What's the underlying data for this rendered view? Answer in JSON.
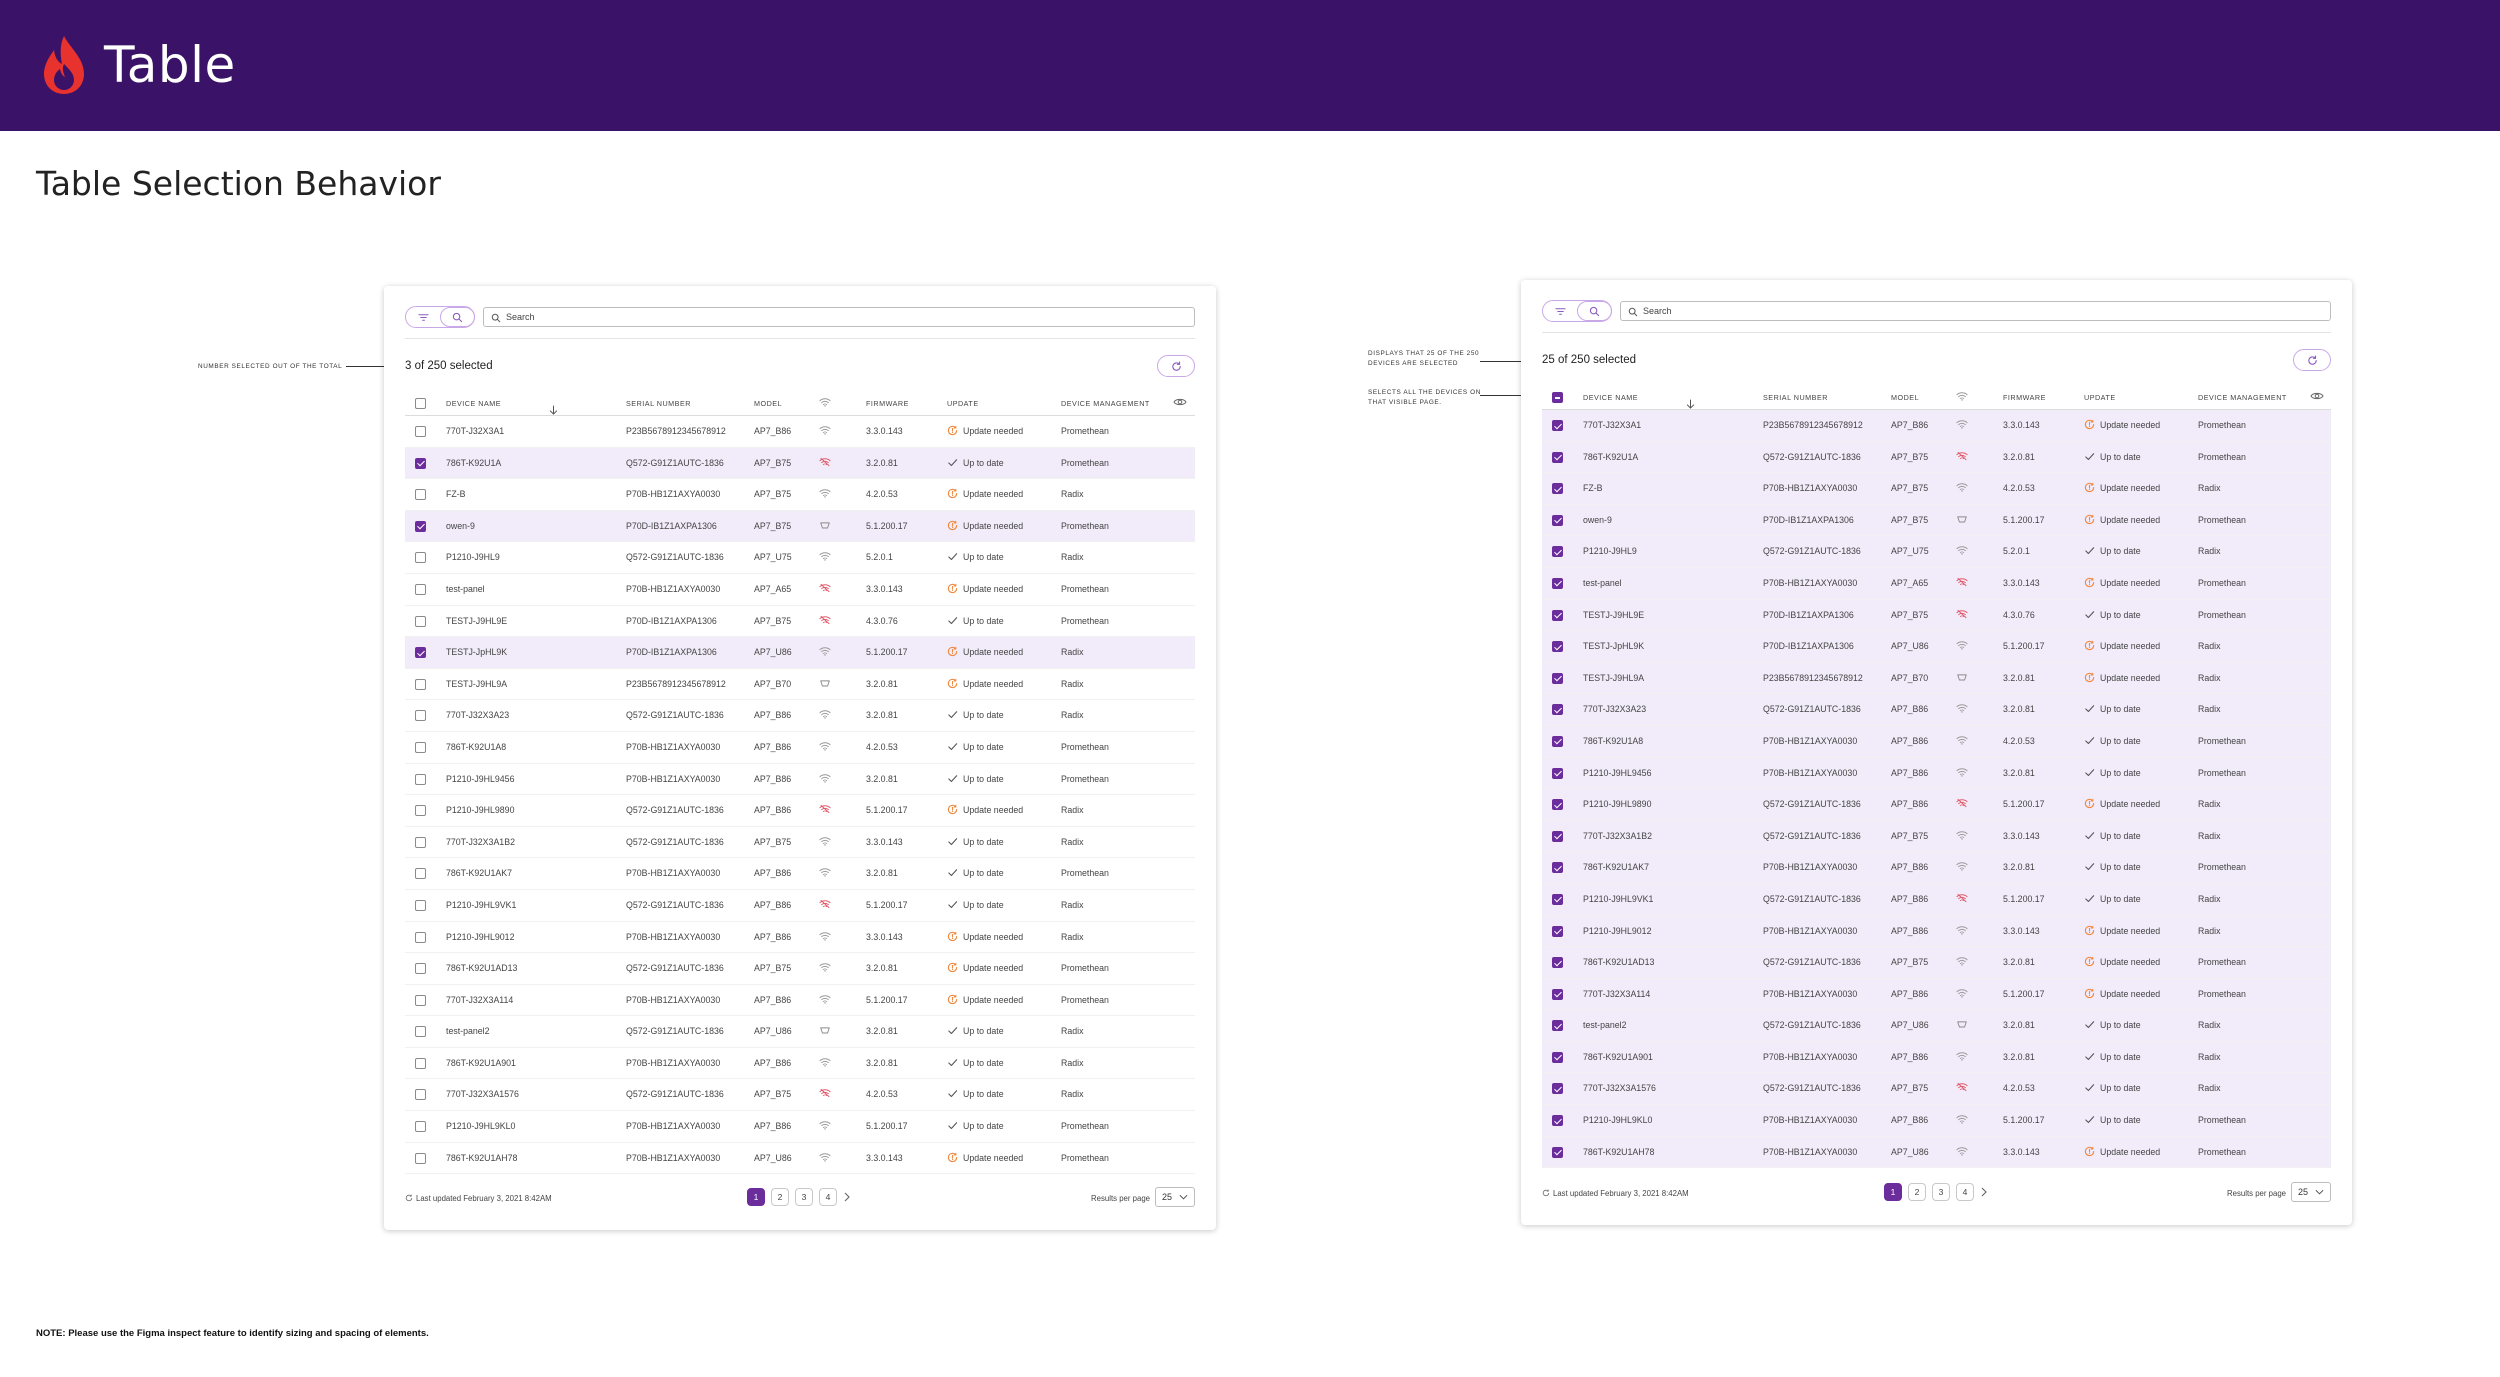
{
  "header": {
    "title": "Table"
  },
  "page": {
    "title": "Table Selection Behavior"
  },
  "note": "NOTE: Please use the Figma inspect feature to identify sizing and spacing of elements.",
  "annotations": {
    "a1": "NUMBER SELECTED OUT OF THE TOTAL",
    "b1": "DISPLAYS THAT 25 OF THE 250 DEVICES ARE SELECTED",
    "b2": "SELECTS ALL THE DEVICES ON THAT VISIBLE PAGE."
  },
  "columns": {
    "device_name": "DEVICE NAME",
    "serial": "SERIAL NUMBER",
    "model": "MODEL",
    "firmware": "FIRMWARE",
    "update": "UPDATE",
    "management": "DEVICE MANAGEMENT"
  },
  "search_placeholder": "Search",
  "colors": {
    "brand": "#3a1268",
    "accent": "#6c2d9c",
    "selected_row": "#f2ecfa",
    "update_needed": "#f0883e",
    "weak_signal": "#e05a6a"
  },
  "footer": {
    "last_updated": "Last updated February 3, 2021 8:42AM",
    "pages": [
      "1",
      "2",
      "3",
      "4"
    ],
    "results_label": "Results per page",
    "results_value": "25"
  },
  "panels": [
    {
      "selected_text": "3 of 250 selected",
      "header_checkbox": "unchecked",
      "rows": [
        {
          "name": "770T-J32X3A1",
          "serial": "P23B5678912345678912",
          "model": "AP7_B86",
          "signal": "wifi",
          "firmware": "3.3.0.143",
          "update": "Update needed",
          "management": "Promethean",
          "selected": false
        },
        {
          "name": "786T-K92U1A",
          "serial": "Q572-G91Z1AUTC-1836",
          "model": "AP7_B75",
          "signal": "wifi-weak",
          "firmware": "3.2.0.81",
          "update": "Up to date",
          "management": "Promethean",
          "selected": true
        },
        {
          "name": "FZ-B",
          "serial": "P70B-HB1Z1AXYA0030",
          "model": "AP7_B75",
          "signal": "wifi",
          "firmware": "4.2.0.53",
          "update": "Update needed",
          "management": "Radix",
          "selected": false
        },
        {
          "name": "owen-9",
          "serial": "P70D-IB1Z1AXPA1306",
          "model": "AP7_B75",
          "signal": "ethernet",
          "firmware": "5.1.200.17",
          "update": "Update needed",
          "management": "Promethean",
          "selected": true
        },
        {
          "name": "P1210-J9HL9",
          "serial": "Q572-G91Z1AUTC-1836",
          "model": "AP7_U75",
          "signal": "wifi",
          "firmware": "5.2.0.1",
          "update": "Up to date",
          "management": "Radix",
          "selected": false
        },
        {
          "name": "test-panel",
          "serial": "P70B-HB1Z1AXYA0030",
          "model": "AP7_A65",
          "signal": "wifi-weak",
          "firmware": "3.3.0.143",
          "update": "Update needed",
          "management": "Promethean",
          "selected": false
        },
        {
          "name": "TESTJ-J9HL9E",
          "serial": "P70D-IB1Z1AXPA1306",
          "model": "AP7_B75",
          "signal": "wifi-weak",
          "firmware": "4.3.0.76",
          "update": "Up to date",
          "management": "Promethean",
          "selected": false
        },
        {
          "name": "TESTJ-JpHL9K",
          "serial": "P70D-IB1Z1AXPA1306",
          "model": "AP7_U86",
          "signal": "wifi",
          "firmware": "5.1.200.17",
          "update": "Update needed",
          "management": "Radix",
          "selected": true
        },
        {
          "name": "TESTJ-J9HL9A",
          "serial": "P23B5678912345678912",
          "model": "AP7_B70",
          "signal": "ethernet",
          "firmware": "3.2.0.81",
          "update": "Update needed",
          "management": "Radix",
          "selected": false
        },
        {
          "name": "770T-J32X3A23",
          "serial": "Q572-G91Z1AUTC-1836",
          "model": "AP7_B86",
          "signal": "wifi",
          "firmware": "3.2.0.81",
          "update": "Up to date",
          "management": "Radix",
          "selected": false
        },
        {
          "name": "786T-K92U1A8",
          "serial": "P70B-HB1Z1AXYA0030",
          "model": "AP7_B86",
          "signal": "wifi",
          "firmware": "4.2.0.53",
          "update": "Up to date",
          "management": "Promethean",
          "selected": false
        },
        {
          "name": "P1210-J9HL9456",
          "serial": "P70B-HB1Z1AXYA0030",
          "model": "AP7_B86",
          "signal": "wifi",
          "firmware": "3.2.0.81",
          "update": "Up to date",
          "management": "Promethean",
          "selected": false
        },
        {
          "name": "P1210-J9HL9890",
          "serial": "Q572-G91Z1AUTC-1836",
          "model": "AP7_B86",
          "signal": "wifi-weak",
          "firmware": "5.1.200.17",
          "update": "Update needed",
          "management": "Radix",
          "selected": false
        },
        {
          "name": "770T-J32X3A1B2",
          "serial": "Q572-G91Z1AUTC-1836",
          "model": "AP7_B75",
          "signal": "wifi",
          "firmware": "3.3.0.143",
          "update": "Up to date",
          "management": "Radix",
          "selected": false
        },
        {
          "name": "786T-K92U1AK7",
          "serial": "P70B-HB1Z1AXYA0030",
          "model": "AP7_B86",
          "signal": "wifi",
          "firmware": "3.2.0.81",
          "update": "Up to date",
          "management": "Promethean",
          "selected": false
        },
        {
          "name": "P1210-J9HL9VK1",
          "serial": "Q572-G91Z1AUTC-1836",
          "model": "AP7_B86",
          "signal": "wifi-weak",
          "firmware": "5.1.200.17",
          "update": "Up to date",
          "management": "Radix",
          "selected": false
        },
        {
          "name": "P1210-J9HL9012",
          "serial": "P70B-HB1Z1AXYA0030",
          "model": "AP7_B86",
          "signal": "wifi",
          "firmware": "3.3.0.143",
          "update": "Update needed",
          "management": "Radix",
          "selected": false
        },
        {
          "name": "786T-K92U1AD13",
          "serial": "Q572-G91Z1AUTC-1836",
          "model": "AP7_B75",
          "signal": "wifi",
          "firmware": "3.2.0.81",
          "update": "Update needed",
          "management": "Promethean",
          "selected": false
        },
        {
          "name": "770T-J32X3A114",
          "serial": "P70B-HB1Z1AXYA0030",
          "model": "AP7_B86",
          "signal": "wifi",
          "firmware": "5.1.200.17",
          "update": "Update needed",
          "management": "Promethean",
          "selected": false
        },
        {
          "name": "test-panel2",
          "serial": "Q572-G91Z1AUTC-1836",
          "model": "AP7_U86",
          "signal": "ethernet",
          "firmware": "3.2.0.81",
          "update": "Up to date",
          "management": "Radix",
          "selected": false
        },
        {
          "name": "786T-K92U1A901",
          "serial": "P70B-HB1Z1AXYA0030",
          "model": "AP7_B86",
          "signal": "wifi",
          "firmware": "3.2.0.81",
          "update": "Up to date",
          "management": "Radix",
          "selected": false
        },
        {
          "name": "770T-J32X3A1576",
          "serial": "Q572-G91Z1AUTC-1836",
          "model": "AP7_B75",
          "signal": "wifi-weak",
          "firmware": "4.2.0.53",
          "update": "Up to date",
          "management": "Radix",
          "selected": false
        },
        {
          "name": "P1210-J9HL9KL0",
          "serial": "P70B-HB1Z1AXYA0030",
          "model": "AP7_B86",
          "signal": "wifi",
          "firmware": "5.1.200.17",
          "update": "Up to date",
          "management": "Promethean",
          "selected": false
        },
        {
          "name": "786T-K92U1AH78",
          "serial": "P70B-HB1Z1AXYA0030",
          "model": "AP7_U86",
          "signal": "wifi",
          "firmware": "3.3.0.143",
          "update": "Update needed",
          "management": "Promethean",
          "selected": false
        }
      ]
    },
    {
      "selected_text": "25 of 250 selected",
      "header_checkbox": "indeterminate",
      "rows": [
        {
          "name": "770T-J32X3A1",
          "serial": "P23B5678912345678912",
          "model": "AP7_B86",
          "signal": "wifi",
          "firmware": "3.3.0.143",
          "update": "Update needed",
          "management": "Promethean",
          "selected": true
        },
        {
          "name": "786T-K92U1A",
          "serial": "Q572-G91Z1AUTC-1836",
          "model": "AP7_B75",
          "signal": "wifi-weak",
          "firmware": "3.2.0.81",
          "update": "Up to date",
          "management": "Promethean",
          "selected": true
        },
        {
          "name": "FZ-B",
          "serial": "P70B-HB1Z1AXYA0030",
          "model": "AP7_B75",
          "signal": "wifi",
          "firmware": "4.2.0.53",
          "update": "Update needed",
          "management": "Radix",
          "selected": true
        },
        {
          "name": "owen-9",
          "serial": "P70D-IB1Z1AXPA1306",
          "model": "AP7_B75",
          "signal": "ethernet",
          "firmware": "5.1.200.17",
          "update": "Update needed",
          "management": "Promethean",
          "selected": true
        },
        {
          "name": "P1210-J9HL9",
          "serial": "Q572-G91Z1AUTC-1836",
          "model": "AP7_U75",
          "signal": "wifi",
          "firmware": "5.2.0.1",
          "update": "Up to date",
          "management": "Radix",
          "selected": true
        },
        {
          "name": "test-panel",
          "serial": "P70B-HB1Z1AXYA0030",
          "model": "AP7_A65",
          "signal": "wifi-weak",
          "firmware": "3.3.0.143",
          "update": "Update needed",
          "management": "Promethean",
          "selected": true
        },
        {
          "name": "TESTJ-J9HL9E",
          "serial": "P70D-IB1Z1AXPA1306",
          "model": "AP7_B75",
          "signal": "wifi-weak",
          "firmware": "4.3.0.76",
          "update": "Up to date",
          "management": "Promethean",
          "selected": true
        },
        {
          "name": "TESTJ-JpHL9K",
          "serial": "P70D-IB1Z1AXPA1306",
          "model": "AP7_U86",
          "signal": "wifi",
          "firmware": "5.1.200.17",
          "update": "Update needed",
          "management": "Radix",
          "selected": true
        },
        {
          "name": "TESTJ-J9HL9A",
          "serial": "P23B5678912345678912",
          "model": "AP7_B70",
          "signal": "ethernet",
          "firmware": "3.2.0.81",
          "update": "Update needed",
          "management": "Radix",
          "selected": true
        },
        {
          "name": "770T-J32X3A23",
          "serial": "Q572-G91Z1AUTC-1836",
          "model": "AP7_B86",
          "signal": "wifi",
          "firmware": "3.2.0.81",
          "update": "Up to date",
          "management": "Radix",
          "selected": true
        },
        {
          "name": "786T-K92U1A8",
          "serial": "P70B-HB1Z1AXYA0030",
          "model": "AP7_B86",
          "signal": "wifi",
          "firmware": "4.2.0.53",
          "update": "Up to date",
          "management": "Promethean",
          "selected": true
        },
        {
          "name": "P1210-J9HL9456",
          "serial": "P70B-HB1Z1AXYA0030",
          "model": "AP7_B86",
          "signal": "wifi",
          "firmware": "3.2.0.81",
          "update": "Up to date",
          "management": "Promethean",
          "selected": true
        },
        {
          "name": "P1210-J9HL9890",
          "serial": "Q572-G91Z1AUTC-1836",
          "model": "AP7_B86",
          "signal": "wifi-weak",
          "firmware": "5.1.200.17",
          "update": "Update needed",
          "management": "Radix",
          "selected": true
        },
        {
          "name": "770T-J32X3A1B2",
          "serial": "Q572-G91Z1AUTC-1836",
          "model": "AP7_B75",
          "signal": "wifi",
          "firmware": "3.3.0.143",
          "update": "Up to date",
          "management": "Radix",
          "selected": true
        },
        {
          "name": "786T-K92U1AK7",
          "serial": "P70B-HB1Z1AXYA0030",
          "model": "AP7_B86",
          "signal": "wifi",
          "firmware": "3.2.0.81",
          "update": "Up to date",
          "management": "Promethean",
          "selected": true
        },
        {
          "name": "P1210-J9HL9VK1",
          "serial": "Q572-G91Z1AUTC-1836",
          "model": "AP7_B86",
          "signal": "wifi-weak",
          "firmware": "5.1.200.17",
          "update": "Up to date",
          "management": "Radix",
          "selected": true
        },
        {
          "name": "P1210-J9HL9012",
          "serial": "P70B-HB1Z1AXYA0030",
          "model": "AP7_B86",
          "signal": "wifi",
          "firmware": "3.3.0.143",
          "update": "Update needed",
          "management": "Radix",
          "selected": true
        },
        {
          "name": "786T-K92U1AD13",
          "serial": "Q572-G91Z1AUTC-1836",
          "model": "AP7_B75",
          "signal": "wifi",
          "firmware": "3.2.0.81",
          "update": "Update needed",
          "management": "Promethean",
          "selected": true
        },
        {
          "name": "770T-J32X3A114",
          "serial": "P70B-HB1Z1AXYA0030",
          "model": "AP7_B86",
          "signal": "wifi",
          "firmware": "5.1.200.17",
          "update": "Update needed",
          "management": "Promethean",
          "selected": true
        },
        {
          "name": "test-panel2",
          "serial": "Q572-G91Z1AUTC-1836",
          "model": "AP7_U86",
          "signal": "ethernet",
          "firmware": "3.2.0.81",
          "update": "Up to date",
          "management": "Radix",
          "selected": true
        },
        {
          "name": "786T-K92U1A901",
          "serial": "P70B-HB1Z1AXYA0030",
          "model": "AP7_B86",
          "signal": "wifi",
          "firmware": "3.2.0.81",
          "update": "Up to date",
          "management": "Radix",
          "selected": true
        },
        {
          "name": "770T-J32X3A1576",
          "serial": "Q572-G91Z1AUTC-1836",
          "model": "AP7_B75",
          "signal": "wifi-weak",
          "firmware": "4.2.0.53",
          "update": "Up to date",
          "management": "Radix",
          "selected": true
        },
        {
          "name": "P1210-J9HL9KL0",
          "serial": "P70B-HB1Z1AXYA0030",
          "model": "AP7_B86",
          "signal": "wifi",
          "firmware": "5.1.200.17",
          "update": "Up to date",
          "management": "Promethean",
          "selected": true
        },
        {
          "name": "786T-K92U1AH78",
          "serial": "P70B-HB1Z1AXYA0030",
          "model": "AP7_U86",
          "signal": "wifi",
          "firmware": "3.3.0.143",
          "update": "Update needed",
          "management": "Promethean",
          "selected": true
        }
      ]
    }
  ]
}
